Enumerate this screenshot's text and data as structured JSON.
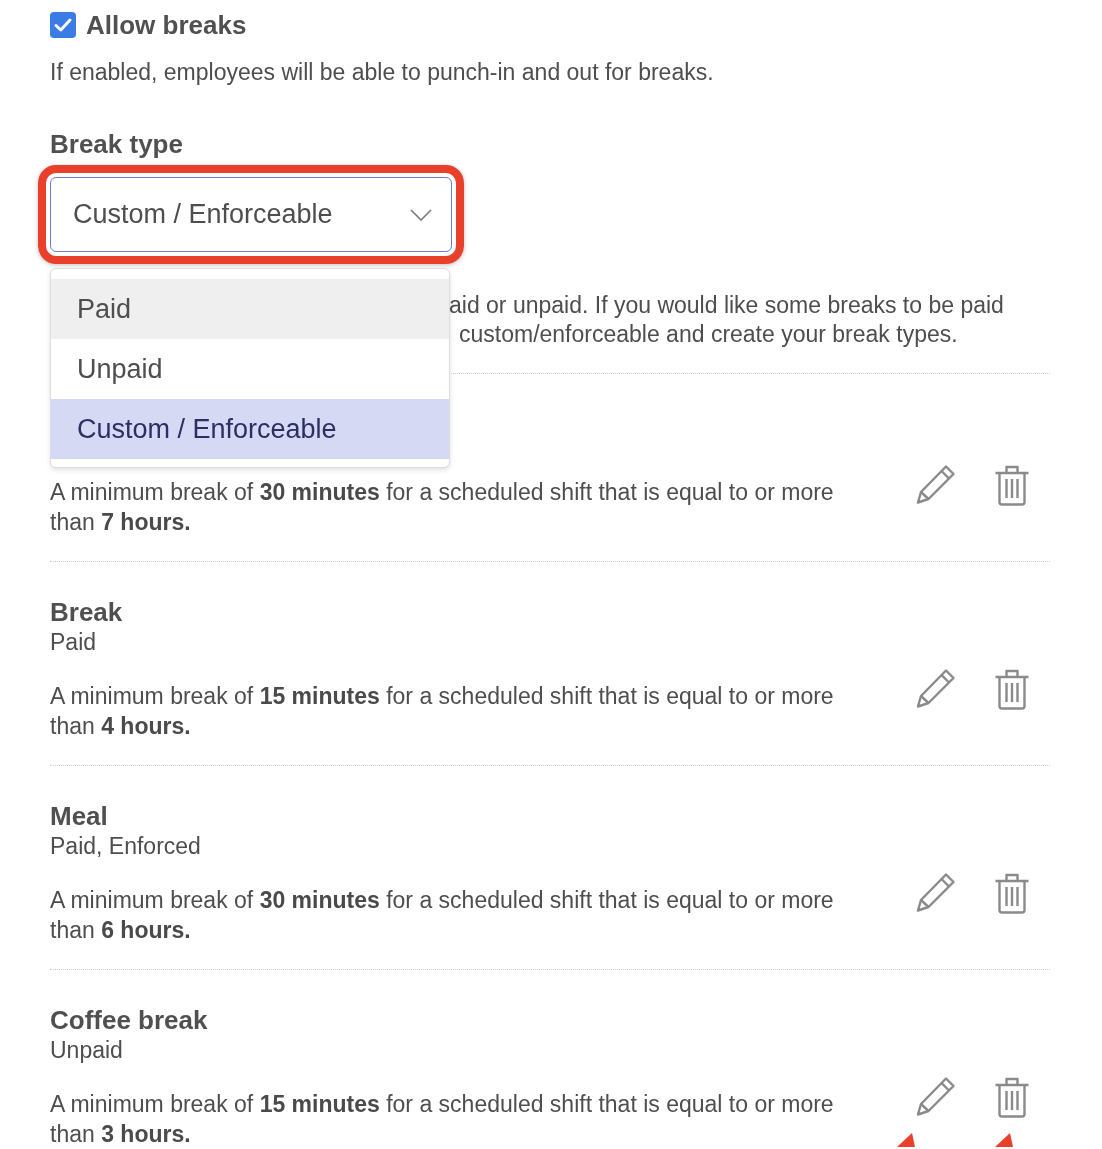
{
  "allow_breaks": {
    "label": "Allow breaks",
    "checked": true,
    "help": "If enabled, employees will be able to punch-in and out for breaks."
  },
  "break_type": {
    "label": "Break type",
    "value": "Custom / Enforceable",
    "highlighted": true,
    "expanded": true,
    "options": [
      {
        "label": "Paid",
        "selected": false,
        "hovered": true
      },
      {
        "label": "Unpaid",
        "selected": false,
        "hovered": false
      },
      {
        "label": "Custom / Enforceable",
        "selected": true,
        "hovered": false
      }
    ]
  },
  "break_type_note": [
    "aid or unpaid. If you would like some breaks to be paid",
    "custom/enforceable and create your break types."
  ],
  "rules": [
    {
      "description": "A minimum break of **30 minutes** for a scheduled shift that is equal to or more than **7 hours.**",
      "annotated": false
    },
    {
      "title": "Break",
      "subtitle": "Paid",
      "description": "A minimum break of **15 minutes** for a scheduled shift that is equal to or more than **4 hours.**",
      "annotated": false
    },
    {
      "title": "Meal",
      "subtitle": "Paid, Enforced",
      "description": "A minimum break of **30 minutes** for a scheduled shift that is equal to or more than **6 hours.**",
      "annotated": false
    },
    {
      "title": "Coffee break",
      "subtitle": "Unpaid",
      "description": "A minimum break of **15 minutes** for a scheduled shift that is equal to or more than **3 hours.**",
      "annotated": true
    }
  ]
}
